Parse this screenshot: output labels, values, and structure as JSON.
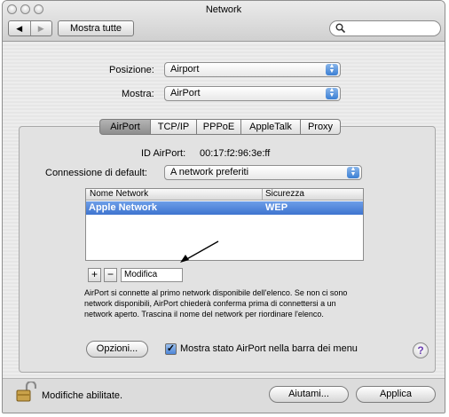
{
  "window": {
    "title": "Network"
  },
  "toolbar": {
    "show_all_label": "Mostra tutte",
    "search_placeholder": ""
  },
  "location": {
    "label": "Posizione:",
    "value": "Airport"
  },
  "show": {
    "label": "Mostra:",
    "value": "AirPort"
  },
  "tabs": [
    {
      "label": "AirPort",
      "active": true
    },
    {
      "label": "TCP/IP",
      "active": false
    },
    {
      "label": "PPPoE",
      "active": false
    },
    {
      "label": "AppleTalk",
      "active": false
    },
    {
      "label": "Proxy",
      "active": false
    }
  ],
  "airport": {
    "id_label": "ID AirPort:",
    "id_value": "00:17:f2:96:3e:ff",
    "default_conn_label": "Connessione di default:",
    "default_conn_value": "A network preferiti",
    "table": {
      "columns": [
        "Nome Network",
        "Sicurezza"
      ],
      "rows": [
        {
          "name": "Apple Network",
          "security": "WEP",
          "selected": true
        }
      ]
    },
    "add_label": "+",
    "remove_label": "−",
    "edit_label": "Modifica",
    "description": "AirPort si connette al primo network disponibile dell'elenco. Se non ci sono network disponibili, AirPort chiederà conferma prima di connettersi a un network aperto. Trascina il nome del network per riordinare l'elenco.",
    "options_label": "Opzioni...",
    "show_status_label": "Mostra stato AirPort nella barra dei menu",
    "show_status_checked": true,
    "help_label": "?"
  },
  "footer": {
    "lock_text": "Modifiche abilitate.",
    "help_button": "Aiutami...",
    "apply_button": "Applica"
  },
  "colors": {
    "selection": "#3e74cf",
    "window_bg": "#ececec"
  },
  "icons": [
    "back-arrow-icon",
    "forward-arrow-icon",
    "search-icon",
    "lock-icon",
    "help-icon"
  ]
}
